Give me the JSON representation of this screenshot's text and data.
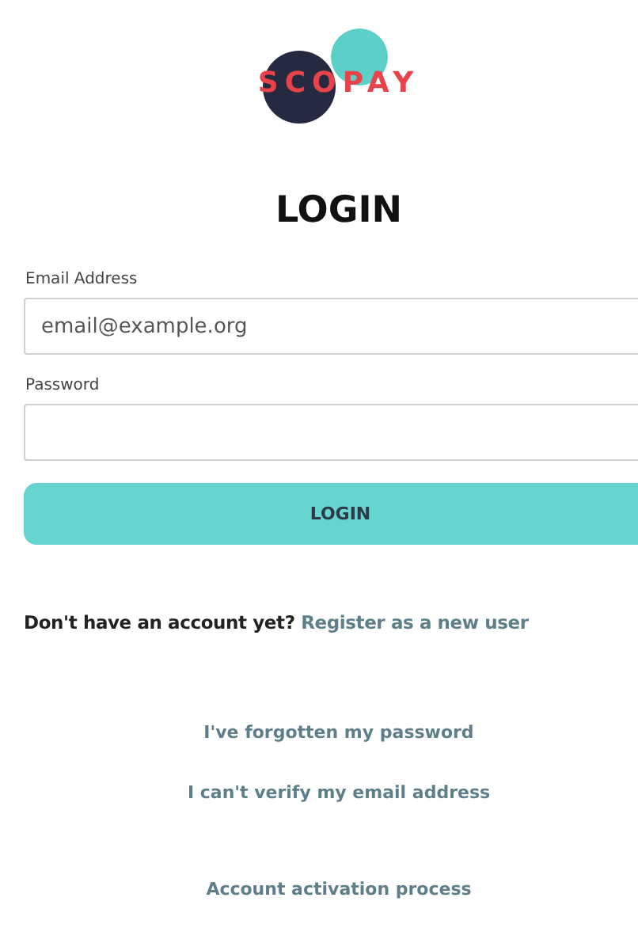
{
  "logo": {
    "text": "SCOPAY"
  },
  "heading": "LOGIN",
  "email_field": {
    "label": "Email Address",
    "placeholder": "email@example.org"
  },
  "password_field": {
    "label": "Password"
  },
  "login_button": "LOGIN",
  "register": {
    "prompt": "Don't have an account yet?",
    "link": "Register as a new user"
  },
  "help_links": [
    "I've forgotten my password",
    "I can't verify my email address"
  ],
  "activation_link": "Account activation process"
}
